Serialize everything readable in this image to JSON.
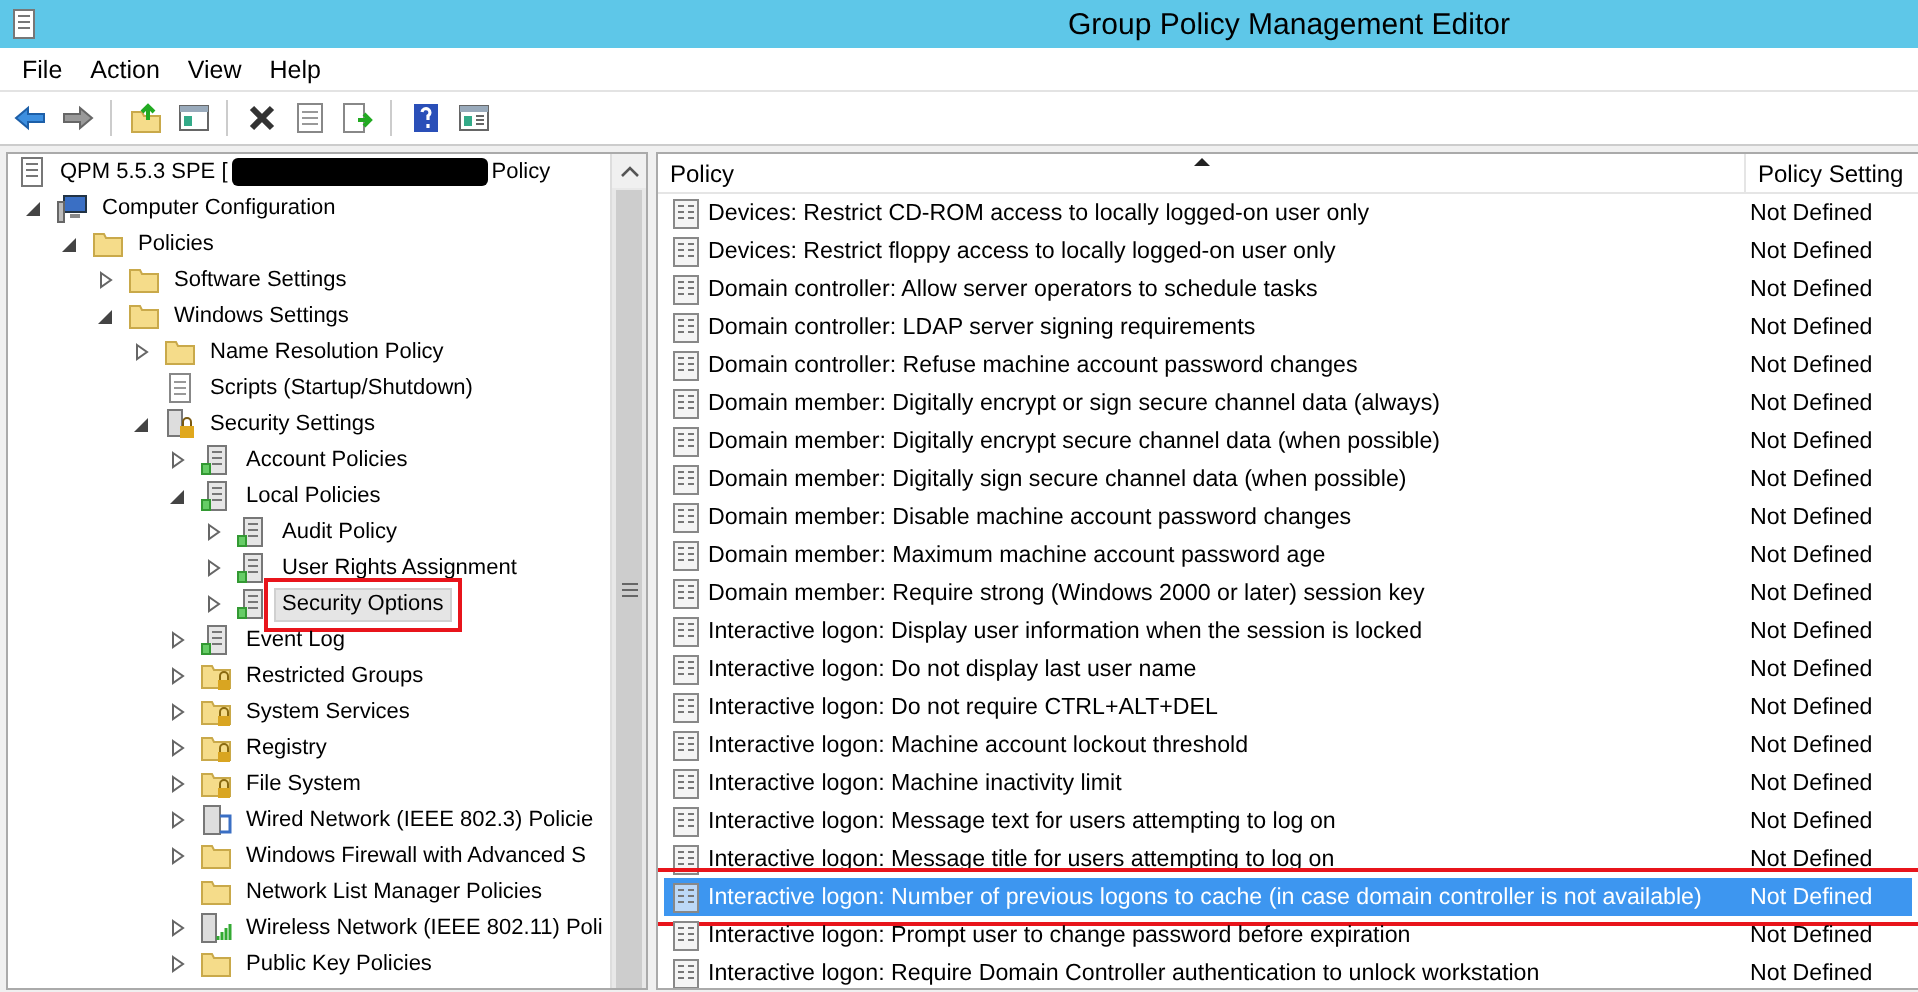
{
  "window": {
    "title": "Group Policy Management Editor"
  },
  "menu": [
    "File",
    "Action",
    "View",
    "Help"
  ],
  "toolbar": [
    {
      "kind": "back",
      "disabled": false
    },
    {
      "kind": "forward",
      "disabled": false
    },
    {
      "kind": "sep"
    },
    {
      "kind": "up-folder",
      "disabled": false
    },
    {
      "kind": "pane",
      "disabled": false
    },
    {
      "kind": "sep"
    },
    {
      "kind": "delete",
      "disabled": false
    },
    {
      "kind": "properties",
      "disabled": false
    },
    {
      "kind": "export",
      "disabled": false
    },
    {
      "kind": "sep"
    },
    {
      "kind": "help",
      "disabled": false
    },
    {
      "kind": "action-pane",
      "disabled": false
    }
  ],
  "tree": {
    "root": {
      "label_start": "QPM 5.5.3 SPE [",
      "label_end": "Policy",
      "redacted": true
    },
    "items": [
      {
        "label": "Computer Configuration",
        "kind": "computer",
        "expanded": true,
        "selected": false,
        "annotated": false,
        "children": [
          {
            "label": "Policies",
            "kind": "folder",
            "expanded": true,
            "selected": false,
            "annotated": false,
            "children": [
              {
                "label": "Software Settings",
                "kind": "folder",
                "expanded": false,
                "selected": false,
                "annotated": false
              },
              {
                "label": "Windows Settings",
                "kind": "folder",
                "expanded": true,
                "selected": false,
                "annotated": false,
                "children": [
                  {
                    "label": "Name Resolution Policy",
                    "kind": "folder",
                    "expanded": false,
                    "selected": false,
                    "annotated": false
                  },
                  {
                    "label": "Scripts (Startup/Shutdown)",
                    "kind": "script",
                    "selected": false,
                    "annotated": false
                  },
                  {
                    "label": "Security Settings",
                    "kind": "security",
                    "expanded": true,
                    "selected": false,
                    "annotated": false,
                    "children": [
                      {
                        "label": "Account Policies",
                        "kind": "policy",
                        "expanded": false,
                        "selected": false,
                        "annotated": false
                      },
                      {
                        "label": "Local Policies",
                        "kind": "policy",
                        "expanded": true,
                        "selected": false,
                        "annotated": false,
                        "children": [
                          {
                            "label": "Audit Policy",
                            "kind": "policy",
                            "expanded": false,
                            "selected": false,
                            "annotated": false
                          },
                          {
                            "label": "User Rights Assignment",
                            "kind": "policy",
                            "expanded": false,
                            "selected": false,
                            "annotated": false
                          },
                          {
                            "label": "Security Options",
                            "kind": "policy",
                            "expanded": false,
                            "selected": true,
                            "annotated": true
                          }
                        ]
                      },
                      {
                        "label": "Event Log",
                        "kind": "policy",
                        "expanded": false,
                        "selected": false,
                        "annotated": false
                      },
                      {
                        "label": "Restricted Groups",
                        "kind": "folder-lock",
                        "expanded": false,
                        "selected": false,
                        "annotated": false
                      },
                      {
                        "label": "System Services",
                        "kind": "folder-lock",
                        "expanded": false,
                        "selected": false,
                        "annotated": false
                      },
                      {
                        "label": "Registry",
                        "kind": "folder-lock",
                        "expanded": false,
                        "selected": false,
                        "annotated": false
                      },
                      {
                        "label": "File System",
                        "kind": "folder-lock",
                        "expanded": false,
                        "selected": false,
                        "annotated": false
                      },
                      {
                        "label": "Wired Network (IEEE 802.3) Policie",
                        "kind": "network",
                        "expanded": false,
                        "selected": false,
                        "annotated": false
                      },
                      {
                        "label": "Windows Firewall with Advanced S",
                        "kind": "folder",
                        "expanded": false,
                        "selected": false,
                        "annotated": false
                      },
                      {
                        "label": "Network List Manager Policies",
                        "kind": "folder",
                        "selected": false,
                        "annotated": false
                      },
                      {
                        "label": "Wireless Network (IEEE 802.11) Poli",
                        "kind": "wireless",
                        "expanded": false,
                        "selected": false,
                        "annotated": false
                      },
                      {
                        "label": "Public Key Policies",
                        "kind": "folder",
                        "expanded": false,
                        "selected": false,
                        "annotated": false
                      }
                    ]
                  }
                ]
              }
            ]
          }
        ]
      }
    ]
  },
  "table": {
    "columns": [
      "Policy",
      "Policy Setting"
    ],
    "sorted_ascending": true,
    "rows": [
      {
        "policy": "Devices: Restrict CD-ROM access to locally logged-on user only",
        "setting": "Not Defined",
        "selected": false,
        "annotated": false
      },
      {
        "policy": "Devices: Restrict floppy access to locally logged-on user only",
        "setting": "Not Defined",
        "selected": false,
        "annotated": false
      },
      {
        "policy": "Domain controller: Allow server operators to schedule tasks",
        "setting": "Not Defined",
        "selected": false,
        "annotated": false
      },
      {
        "policy": "Domain controller: LDAP server signing requirements",
        "setting": "Not Defined",
        "selected": false,
        "annotated": false
      },
      {
        "policy": "Domain controller: Refuse machine account password changes",
        "setting": "Not Defined",
        "selected": false,
        "annotated": false
      },
      {
        "policy": "Domain member: Digitally encrypt or sign secure channel data (always)",
        "setting": "Not Defined",
        "selected": false,
        "annotated": false
      },
      {
        "policy": "Domain member: Digitally encrypt secure channel data (when possible)",
        "setting": "Not Defined",
        "selected": false,
        "annotated": false
      },
      {
        "policy": "Domain member: Digitally sign secure channel data (when possible)",
        "setting": "Not Defined",
        "selected": false,
        "annotated": false
      },
      {
        "policy": "Domain member: Disable machine account password changes",
        "setting": "Not Defined",
        "selected": false,
        "annotated": false
      },
      {
        "policy": "Domain member: Maximum machine account password age",
        "setting": "Not Defined",
        "selected": false,
        "annotated": false
      },
      {
        "policy": "Domain member: Require strong (Windows 2000 or later) session key",
        "setting": "Not Defined",
        "selected": false,
        "annotated": false
      },
      {
        "policy": "Interactive logon: Display user information when the session is locked",
        "setting": "Not Defined",
        "selected": false,
        "annotated": false
      },
      {
        "policy": "Interactive logon: Do not display last user name",
        "setting": "Not Defined",
        "selected": false,
        "annotated": false
      },
      {
        "policy": "Interactive logon: Do not require CTRL+ALT+DEL",
        "setting": "Not Defined",
        "selected": false,
        "annotated": false
      },
      {
        "policy": "Interactive logon: Machine account lockout threshold",
        "setting": "Not Defined",
        "selected": false,
        "annotated": false
      },
      {
        "policy": "Interactive logon: Machine inactivity limit",
        "setting": "Not Defined",
        "selected": false,
        "annotated": false
      },
      {
        "policy": "Interactive logon: Message text for users attempting to log on",
        "setting": "Not Defined",
        "selected": false,
        "annotated": false
      },
      {
        "policy": "Interactive logon: Message title for users attempting to log on",
        "setting": "Not Defined",
        "selected": false,
        "annotated": false
      },
      {
        "policy": "Interactive logon: Number of previous logons to cache (in case domain controller is not available)",
        "setting": "Not Defined",
        "selected": true,
        "annotated": true
      },
      {
        "policy": "Interactive logon: Prompt user to change password before expiration",
        "setting": "Not Defined",
        "selected": false,
        "annotated": false
      },
      {
        "policy": "Interactive logon: Require Domain Controller authentication to unlock workstation",
        "setting": "Not Defined",
        "selected": false,
        "annotated": false
      }
    ]
  }
}
